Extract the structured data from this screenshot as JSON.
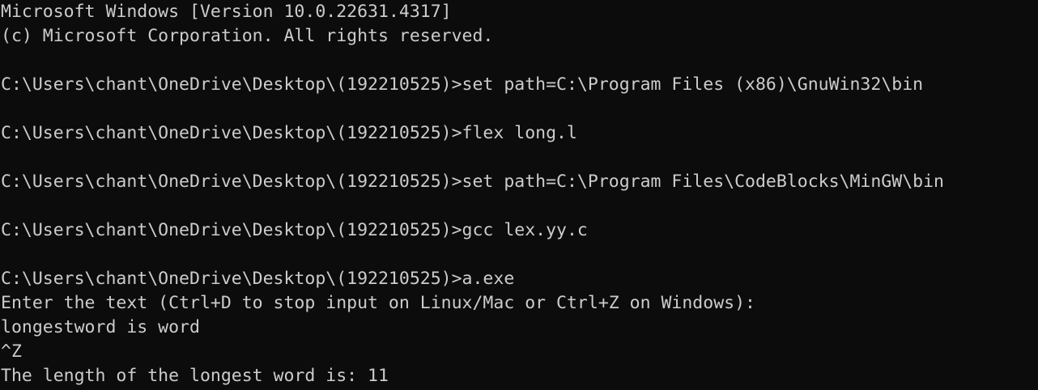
{
  "terminal": {
    "background": "#0c0c0c",
    "foreground": "#cccccc",
    "lines": [
      "Microsoft Windows [Version 10.0.22631.4317]",
      "(c) Microsoft Corporation. All rights reserved.",
      "",
      "C:\\Users\\chant\\OneDrive\\Desktop\\(192210525)>set path=C:\\Program Files (x86)\\GnuWin32\\bin",
      "",
      "C:\\Users\\chant\\OneDrive\\Desktop\\(192210525)>flex long.l",
      "",
      "C:\\Users\\chant\\OneDrive\\Desktop\\(192210525)>set path=C:\\Program Files\\CodeBlocks\\MinGW\\bin",
      "",
      "C:\\Users\\chant\\OneDrive\\Desktop\\(192210525)>gcc lex.yy.c",
      "",
      "C:\\Users\\chant\\OneDrive\\Desktop\\(192210525)>a.exe",
      "Enter the text (Ctrl+D to stop input on Linux/Mac or Ctrl+Z on Windows):",
      "longestword is word",
      "^Z",
      "The length of the longest word is: 11"
    ]
  }
}
